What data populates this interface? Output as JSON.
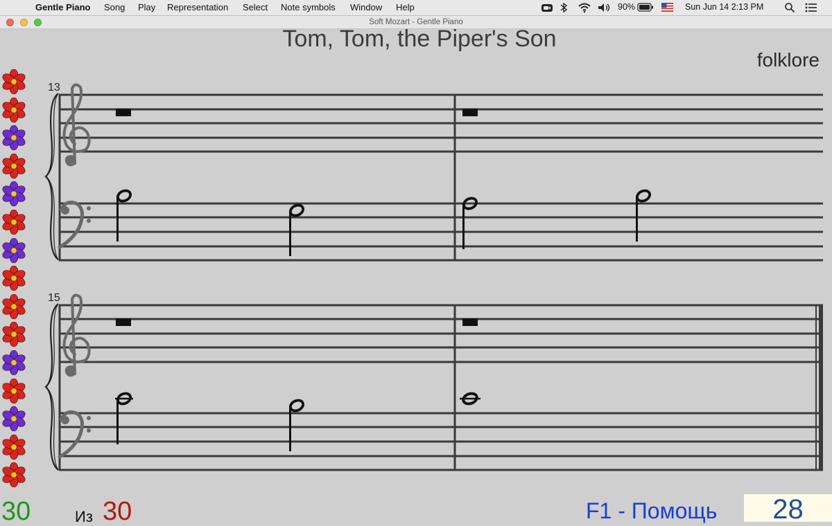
{
  "menubar": {
    "app_name": "Gentle Piano",
    "items": [
      "Song",
      "Play",
      "Representation",
      "Select",
      "Note symbols",
      "Window",
      "Help"
    ],
    "battery": "90%",
    "datetime": "Sun Jun 14  2:13 PM"
  },
  "window": {
    "title": "Soft Mozart - Gentle Piano"
  },
  "song": {
    "title": "Tom, Tom, the Piper's Son",
    "composer": "folklore"
  },
  "score": {
    "systems": [
      {
        "first_measure": "13"
      },
      {
        "first_measure": "15"
      }
    ]
  },
  "flowers": [
    "red",
    "red",
    "purple",
    "red",
    "purple",
    "red",
    "purple",
    "red",
    "red",
    "red",
    "purple",
    "red",
    "purple",
    "red",
    "red"
  ],
  "colors": {
    "red_flower": "#d8261e",
    "purple_flower": "#6a2fd0",
    "done": "#1a9a1a",
    "total": "#b11a12",
    "help": "#1a3ed6",
    "score": "#1c4fa0"
  },
  "footer": {
    "done": "30",
    "of_label": "Из",
    "total": "30",
    "help": "F1 - Помощь",
    "score_value": "28"
  }
}
